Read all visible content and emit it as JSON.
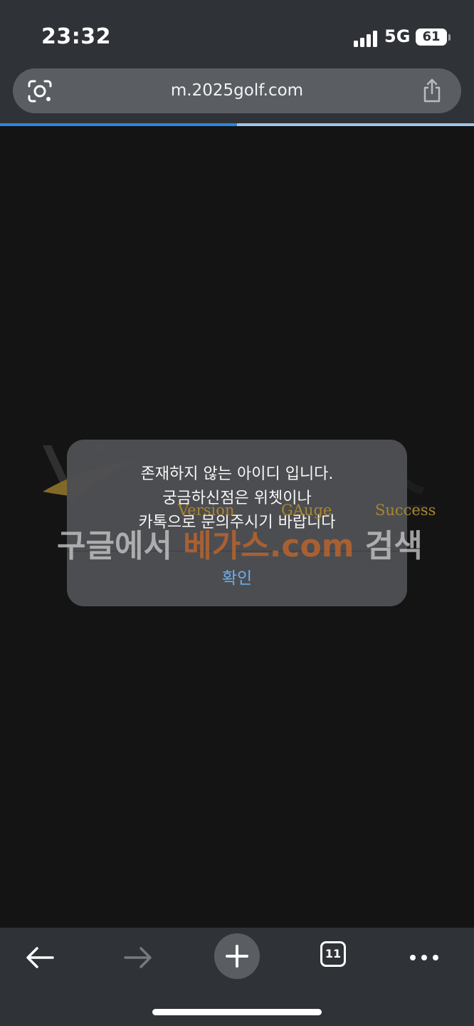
{
  "status_bar": {
    "time": "23:32",
    "network": "5G",
    "battery": "61",
    "icons": [
      "signal-bars-icon",
      "battery-icon"
    ]
  },
  "browser": {
    "url": "m.2025golf.com",
    "icons": [
      "lens-camera-icon",
      "share-icon"
    ],
    "load_progress": 0.5,
    "colors": {
      "progress": "#2c86e0",
      "progress_track": "#9fc6ee"
    }
  },
  "watermark": {
    "brand_chars": [
      "베",
      "가",
      "스"
    ],
    "words": [
      "Version",
      "GAuge",
      "Success"
    ],
    "banner": {
      "prefix": "구글에서 ",
      "brand": "베가스.com",
      "suffix": " 검색"
    },
    "colors": {
      "banner_prefix": "#c8c8c8",
      "banner_brand": "#c2662a",
      "words": "#a9862f"
    }
  },
  "dialog": {
    "message_lines": [
      "존재하지 않는 아이디 입니다.",
      "궁금하신점은 위쳇이나",
      "카톡으로 문의주시기 바랍니다"
    ],
    "confirm_label": "확인",
    "colors": {
      "button_text": "#6fb3f5",
      "background": "#4e4f53"
    }
  },
  "toolbar": {
    "tab_count": "11",
    "icons": [
      "back-arrow-icon",
      "forward-arrow-icon",
      "plus-icon",
      "tabs-icon",
      "more-icon"
    ]
  }
}
